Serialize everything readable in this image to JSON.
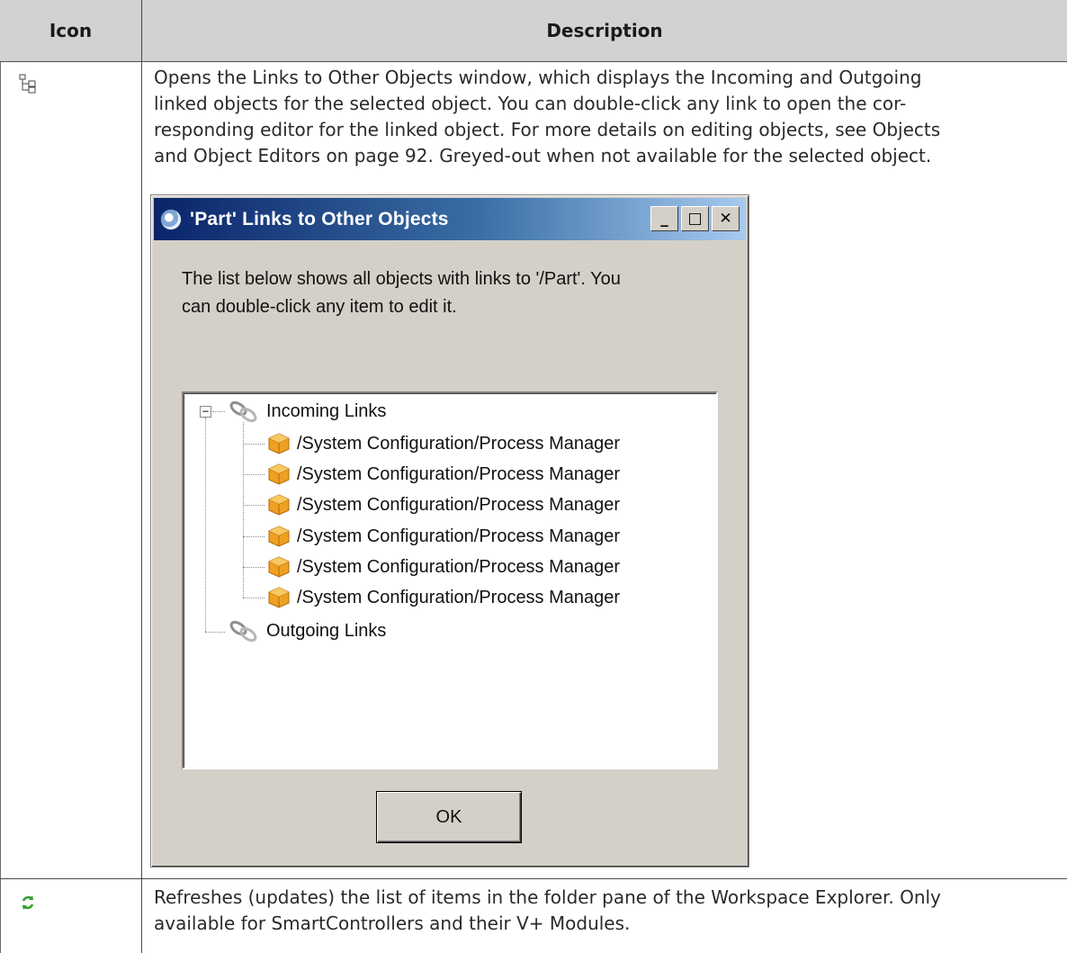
{
  "table": {
    "header_icon": "Icon",
    "header_description": "Description"
  },
  "rows": [
    {
      "icon": "tree-links-icon",
      "description_lines": [
        "Opens the Links to Other Objects window, which displays the Incoming and Outgoing",
        "linked objects for the selected object. You can double-click any link to open the cor-",
        "responding editor for the linked object. For more details on editing objects, see Objects",
        "and Object Editors on page 92. Greyed-out when not available for the selected object."
      ]
    },
    {
      "icon": "refresh-icon",
      "description_lines": [
        "Refreshes (updates) the list of items in the folder pane of the Workspace Explorer. Only",
        "available for SmartControllers and their V+ Modules."
      ]
    }
  ],
  "dialog": {
    "title": "'Part' Links to Other Objects",
    "minimize": "_",
    "maximize": "□",
    "close": "✕",
    "message_line1": "The list below shows all objects with links to '/Part'. You",
    "message_line2": "can double-click any item to edit it.",
    "tree": {
      "incoming_label": "Incoming Links",
      "incoming_items": [
        "/System Configuration/Process Manager",
        "/System Configuration/Process Manager",
        "/System Configuration/Process Manager",
        "/System Configuration/Process Manager",
        "/System Configuration/Process Manager",
        "/System Configuration/Process Manager"
      ],
      "outgoing_label": "Outgoing Links",
      "expander_symbol": "−"
    },
    "ok_label": "OK"
  },
  "colors": {
    "header_bg": "#d2d2d2",
    "dialog_bg": "#d4d0c8",
    "titlebar_start": "#0a246a",
    "titlebar_end": "#a6caf0",
    "package_orange": "#f0a020"
  }
}
